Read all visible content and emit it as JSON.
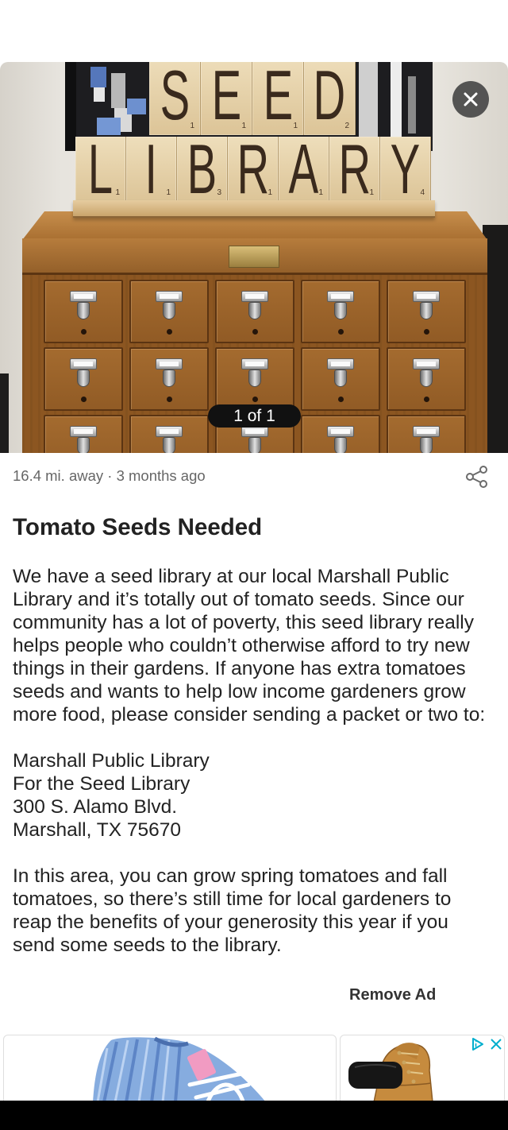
{
  "colors": {
    "text": "#222222",
    "meta_text": "#666666",
    "photo_counter_bg": "#111111",
    "ad_choices": "#00aecd",
    "nav_bar": "#000000"
  },
  "photo": {
    "counter": "1 of 1",
    "close_icon": "close-icon",
    "sign": {
      "rows": [
        {
          "tiles": [
            {
              "letter": "S",
              "points": "1"
            },
            {
              "letter": "E",
              "points": "1"
            },
            {
              "letter": "E",
              "points": "1"
            },
            {
              "letter": "D",
              "points": "2"
            }
          ]
        },
        {
          "tiles": [
            {
              "letter": "L",
              "points": "1"
            },
            {
              "letter": "I",
              "points": "1"
            },
            {
              "letter": "B",
              "points": "3"
            },
            {
              "letter": "R",
              "points": "1"
            },
            {
              "letter": "A",
              "points": "1"
            },
            {
              "letter": "R",
              "points": "1"
            },
            {
              "letter": "Y",
              "points": "4"
            }
          ]
        }
      ]
    }
  },
  "listing": {
    "meta": "16.4 mi. away · 3 months ago",
    "share_icon": "share-icon",
    "title": "Tomato Seeds Needed",
    "description": [
      [
        "We have a seed library at our local Marshall Public",
        "Library and it’s totally out of tomato seeds. Since our",
        "community has a lot of poverty, this seed library really",
        "helps people who couldn’t otherwise afford to try new",
        "things in their gardens. If anyone has extra tomatoes",
        "seeds and wants to help low income gardeners grow",
        "more food, please consider sending a packet or two to:"
      ],
      [
        "Marshall Public Library",
        "For the Seed Library",
        "300 S. Alamo Blvd.",
        "Marshall, TX 75670"
      ],
      [
        "In this area, you can grow spring tomatoes and fall",
        "tomatoes, so there’s still time for local gardeners to",
        "reap the benefits of your generosity this year if you",
        "send some seeds to the library."
      ]
    ]
  },
  "ad": {
    "remove_label": "Remove Ad",
    "adchoices_icon": "adchoices-icon",
    "close_icon": "close-icon"
  }
}
